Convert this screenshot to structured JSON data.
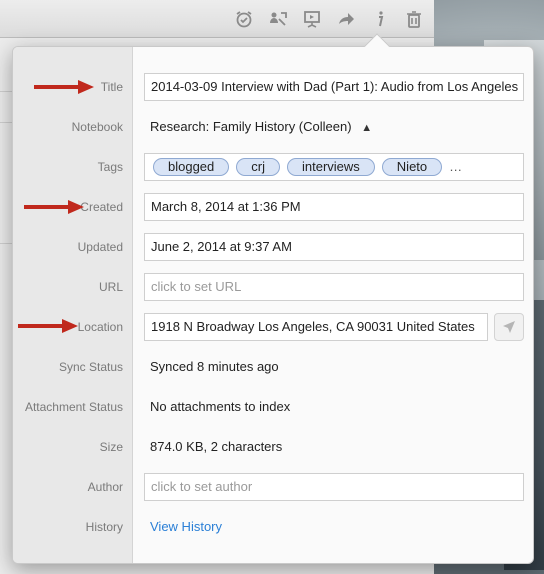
{
  "toolbar": {
    "icons": [
      "alarm-check-icon",
      "share-people-icon",
      "presentation-icon",
      "forward-icon",
      "info-icon",
      "trash-icon"
    ]
  },
  "info": {
    "title_label": "Title",
    "title_value": "2014-03-09 Interview with Dad (Part 1): Audio from Los Angeles",
    "notebook_label": "Notebook",
    "notebook_value": "Research: Family History (Colleen)",
    "notebook_stepper": "▲▼",
    "tags_label": "Tags",
    "tags": [
      "blogged",
      "crj",
      "interviews",
      "Nieto"
    ],
    "tags_more": "…",
    "created_label": "Created",
    "created_value": "March 8, 2014 at 1:36 PM",
    "updated_label": "Updated",
    "updated_value": "June 2, 2014 at 9:37 AM",
    "url_label": "URL",
    "url_placeholder": "click to set URL",
    "location_label": "Location",
    "location_value": "1918 N Broadway Los Angeles, CA  90031 United States",
    "sync_label": "Sync Status",
    "sync_value": "Synced 8 minutes ago",
    "attachment_label": "Attachment Status",
    "attachment_value": "No attachments to index",
    "size_label": "Size",
    "size_value": "874.0 KB, 2 characters",
    "author_label": "Author",
    "author_placeholder": "click to set author",
    "history_label": "History",
    "history_link": "View History"
  },
  "colors": {
    "annotation_arrow": "#c0281c",
    "link": "#2a7fd6",
    "tag_fill": "#d9e4f6"
  }
}
